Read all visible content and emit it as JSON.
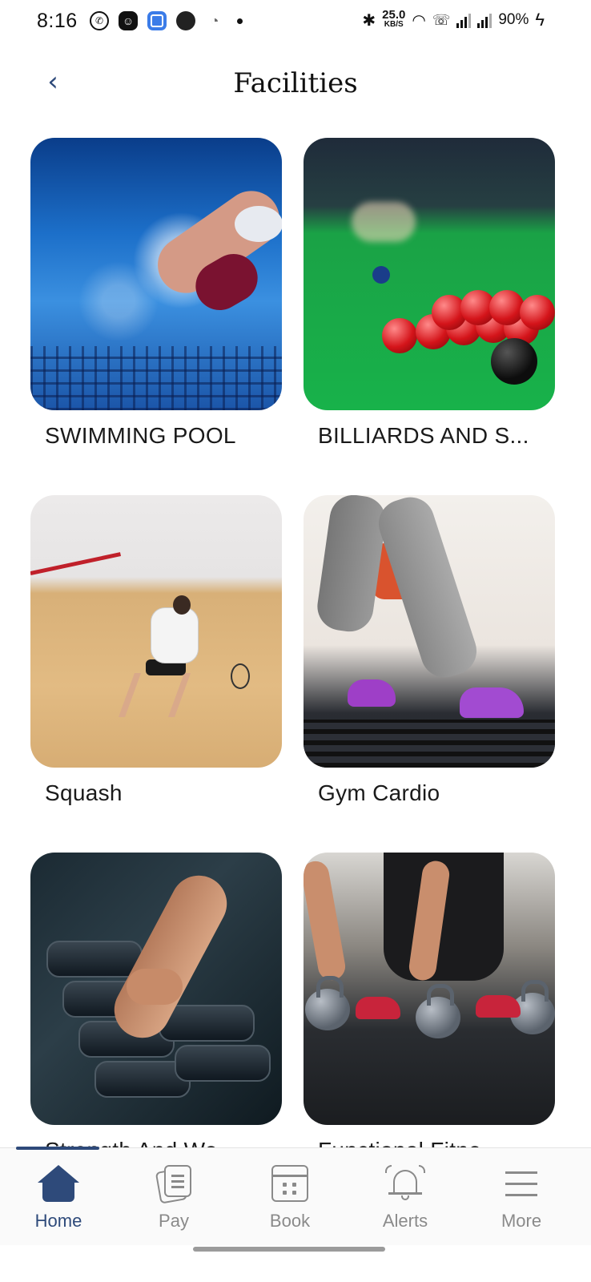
{
  "status_bar": {
    "time": "8:16",
    "net_speed_value": "25.0",
    "net_speed_unit": "KB/S",
    "battery": "90%",
    "icons": [
      "whatsapp-icon",
      "snapchat-icon",
      "app-icon",
      "notification-icon",
      "cat-icon",
      "dot-icon",
      "bluetooth-icon",
      "wifi-icon",
      "volte-icon",
      "signal-icon",
      "signal-icon",
      "battery-charging-icon"
    ]
  },
  "header": {
    "title": "Facilities",
    "back_icon": "chevron-left-icon"
  },
  "facilities": [
    {
      "label": "SWIMMING POOL",
      "image": "swimming-pool-photo"
    },
    {
      "label": "BILLIARDS AND S...",
      "image": "billiards-photo"
    },
    {
      "label": "Squash",
      "image": "squash-photo"
    },
    {
      "label": "Gym Cardio",
      "image": "gym-cardio-photo"
    },
    {
      "label": "Strength And We",
      "image": "strength-photo"
    },
    {
      "label": "Functional Fitne",
      "image": "functional-fitness-photo"
    }
  ],
  "bottom_nav": {
    "active": "Home",
    "items": [
      {
        "label": "Home",
        "icon": "home-icon"
      },
      {
        "label": "Pay",
        "icon": "pay-icon"
      },
      {
        "label": "Book",
        "icon": "calendar-icon"
      },
      {
        "label": "Alerts",
        "icon": "bell-icon"
      },
      {
        "label": "More",
        "icon": "menu-icon"
      }
    ]
  },
  "colors": {
    "accent": "#2e4a7a",
    "inactive": "#8a8a8a"
  }
}
